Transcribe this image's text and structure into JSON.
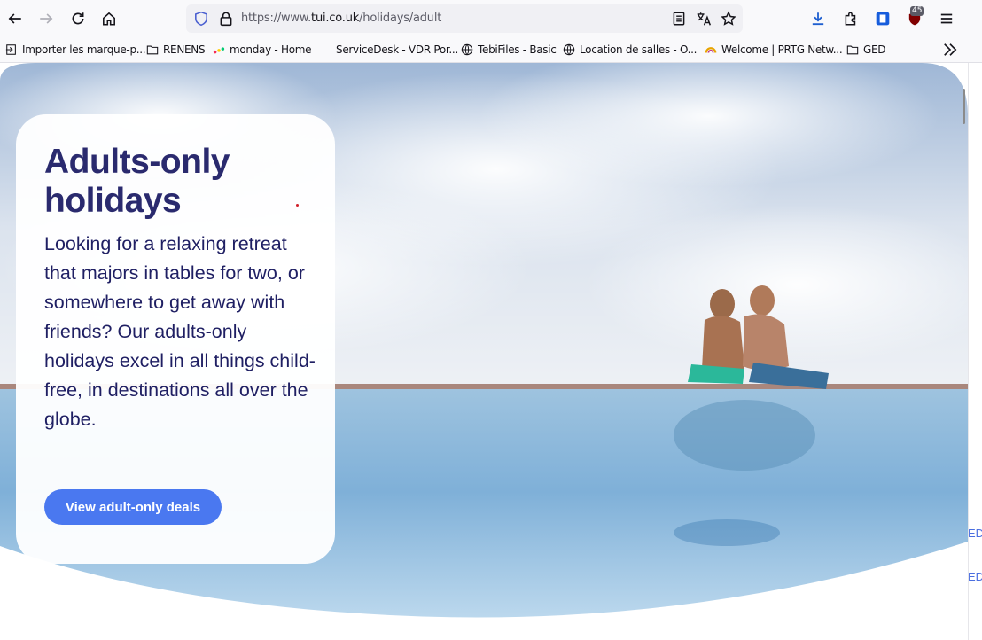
{
  "browser": {
    "url_prefix": "https://www.",
    "url_domain": "tui.co.uk",
    "url_path": "/holidays/adult",
    "extension_badge": "45"
  },
  "bookmarks": [
    {
      "label": "Importer les marque-p...",
      "icon": "import-icon"
    },
    {
      "label": "RENENS",
      "icon": "folder-icon"
    },
    {
      "label": "monday - Home",
      "icon": "monday-icon"
    },
    {
      "label": "ServiceDesk - VDR Por...",
      "icon": "blank-icon"
    },
    {
      "label": "TebiFiles - Basic",
      "icon": "globe-icon"
    },
    {
      "label": "Location de salles - O...",
      "icon": "globe-icon"
    },
    {
      "label": "Welcome | PRTG Netw...",
      "icon": "prtg-icon"
    },
    {
      "label": "GED",
      "icon": "folder-icon"
    }
  ],
  "hero": {
    "title": "Adults-only holidays",
    "description": "Looking for a relaxing retreat that majors in tables for two, or somewhere to get away with friends? Our adults-only holidays excel in all things child-free, in destinations all over the globe.",
    "cta_label": "View adult-only deals"
  },
  "edge_texts": [
    "ED",
    "ED"
  ],
  "colors": {
    "title": "#2a2a6e",
    "cta": "#4a78f0"
  }
}
